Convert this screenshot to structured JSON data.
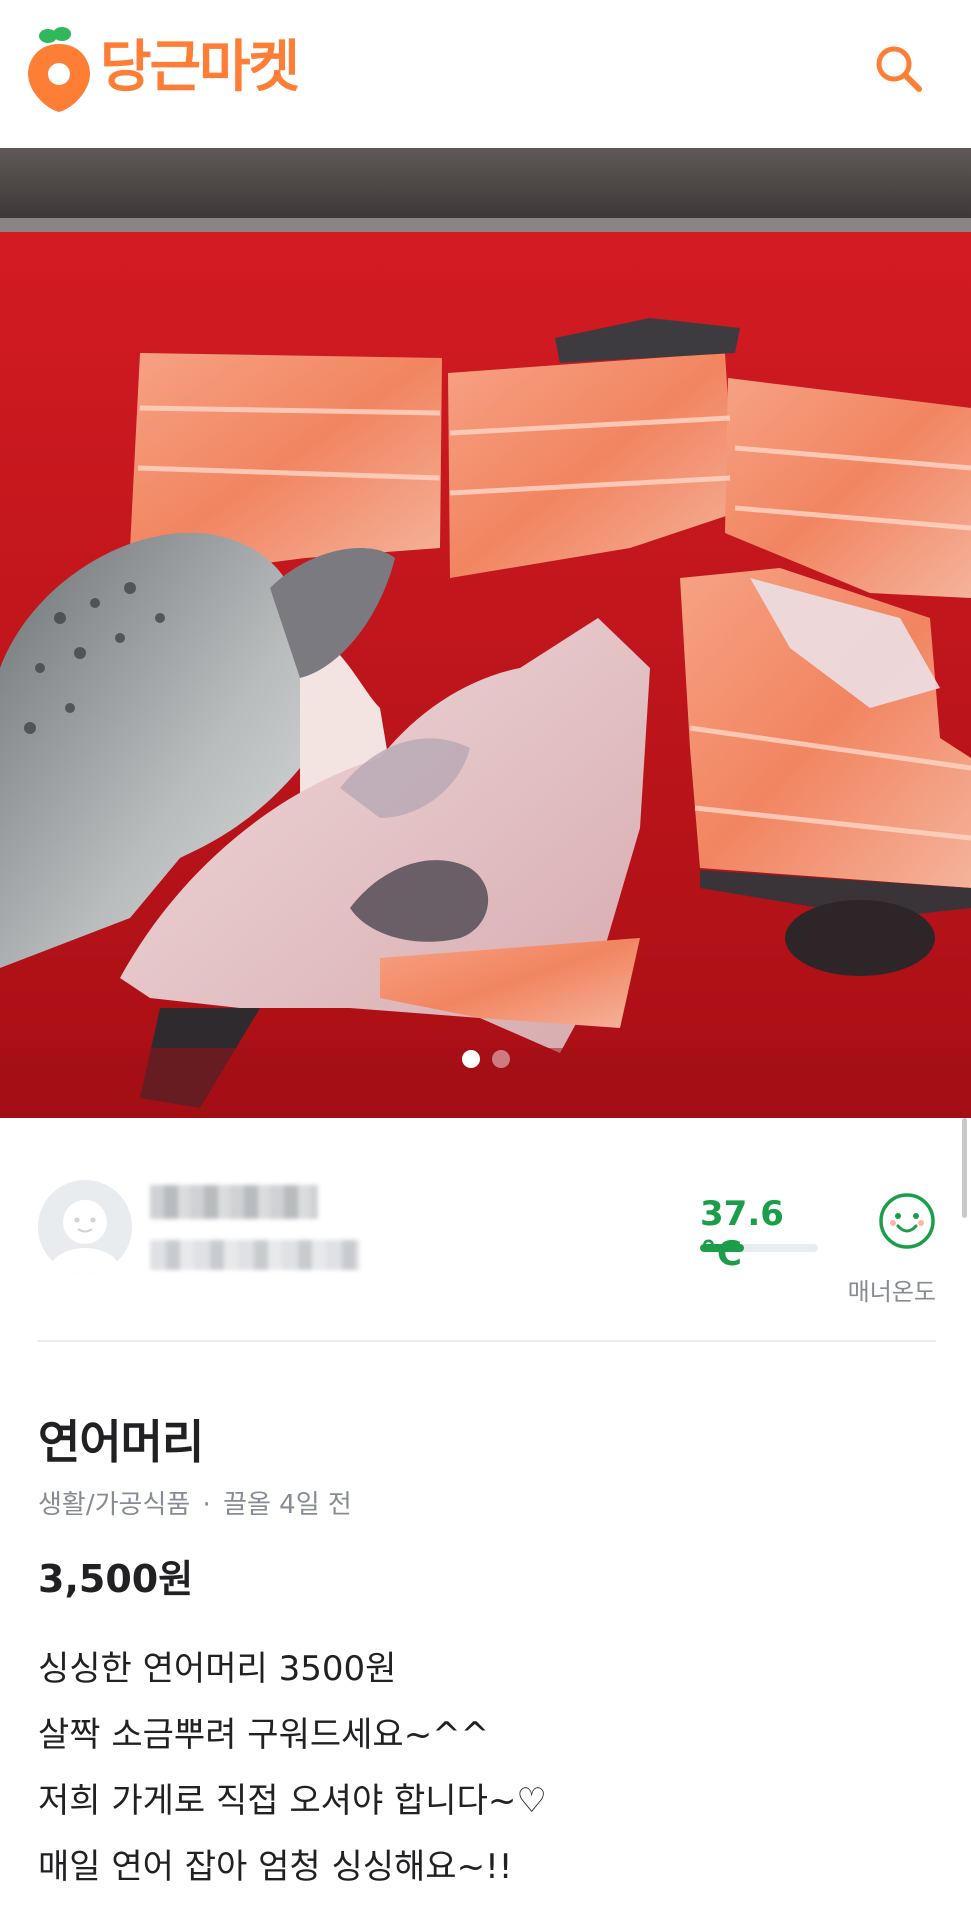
{
  "app": {
    "brand_name": "당근마켓",
    "brand_color": "#ff7e36",
    "search_icon": "search-icon"
  },
  "photo": {
    "description_icon": "product-photo",
    "slide_count": 2,
    "active_slide": 1
  },
  "seller": {
    "nickname": "",
    "region": "",
    "manner_temperature": "37.6 °C",
    "manner_temperature_value": 37.6,
    "manner_label": "매너온도",
    "temperature_color": "#1a9e4a"
  },
  "article": {
    "title": "연어머리",
    "category": "생활/가공식품",
    "separator": "·",
    "bumped": "끌올 4일 전",
    "price": "3,500원",
    "description_lines": [
      "싱싱한 연어머리 3500원",
      "살짝 소금뿌려 구워드세요~^^",
      "저희 가게로 직접 오셔야 합니다~♡",
      "매일 연어 잡아 엄청 싱싱해요~!!"
    ]
  }
}
